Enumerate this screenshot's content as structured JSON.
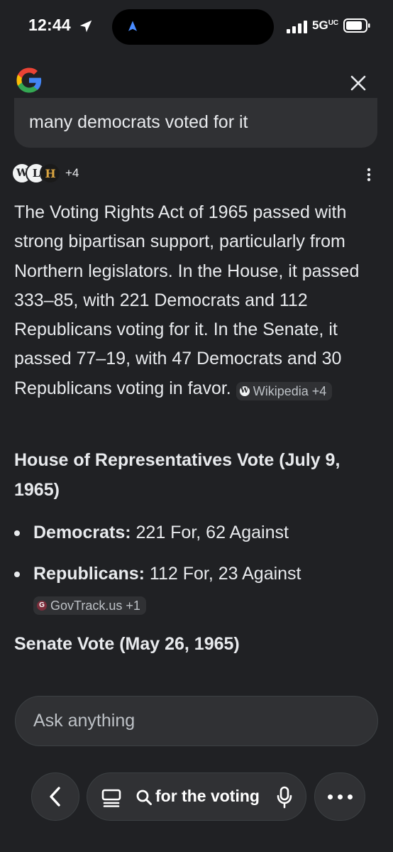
{
  "status_bar": {
    "time": "12:44",
    "network": "5G",
    "network_suffix": "UC"
  },
  "header": {
    "logo": "google-g-icon",
    "close_icon": "close-icon"
  },
  "query": {
    "visible_text": "many democrats voted for it"
  },
  "sources": {
    "icons": [
      "W",
      "L",
      "H"
    ],
    "more_label": "+4"
  },
  "answer": {
    "paragraph": "The Voting Rights Act of 1965 passed with strong bipartisan support, particularly from Northern legislators. In the House, it passed 333–85, with 221 Democrats and 112 Republicans voting for it. In the Senate, it passed 77–19, with 47 Democrats and 30 Republicans voting in favor.",
    "citation_chip": "Wikipedia +4"
  },
  "house_section": {
    "heading": "House of Representatives Vote (July 9, 1965)",
    "bullets": [
      {
        "label": "Democrats:",
        "text": " 221 For, 62 Against"
      },
      {
        "label": "Republicans:",
        "text": " 112 For, 23 Against"
      }
    ],
    "citation_chip": "GovTrack.us +1"
  },
  "senate_section": {
    "heading": "Senate Vote (May 26, 1965)"
  },
  "ask_box": {
    "placeholder": "Ask anything"
  },
  "bottom_nav": {
    "pill_text": "for the voting"
  },
  "colors": {
    "background": "#202124",
    "surface": "#303134",
    "text": "#e8eaed"
  }
}
